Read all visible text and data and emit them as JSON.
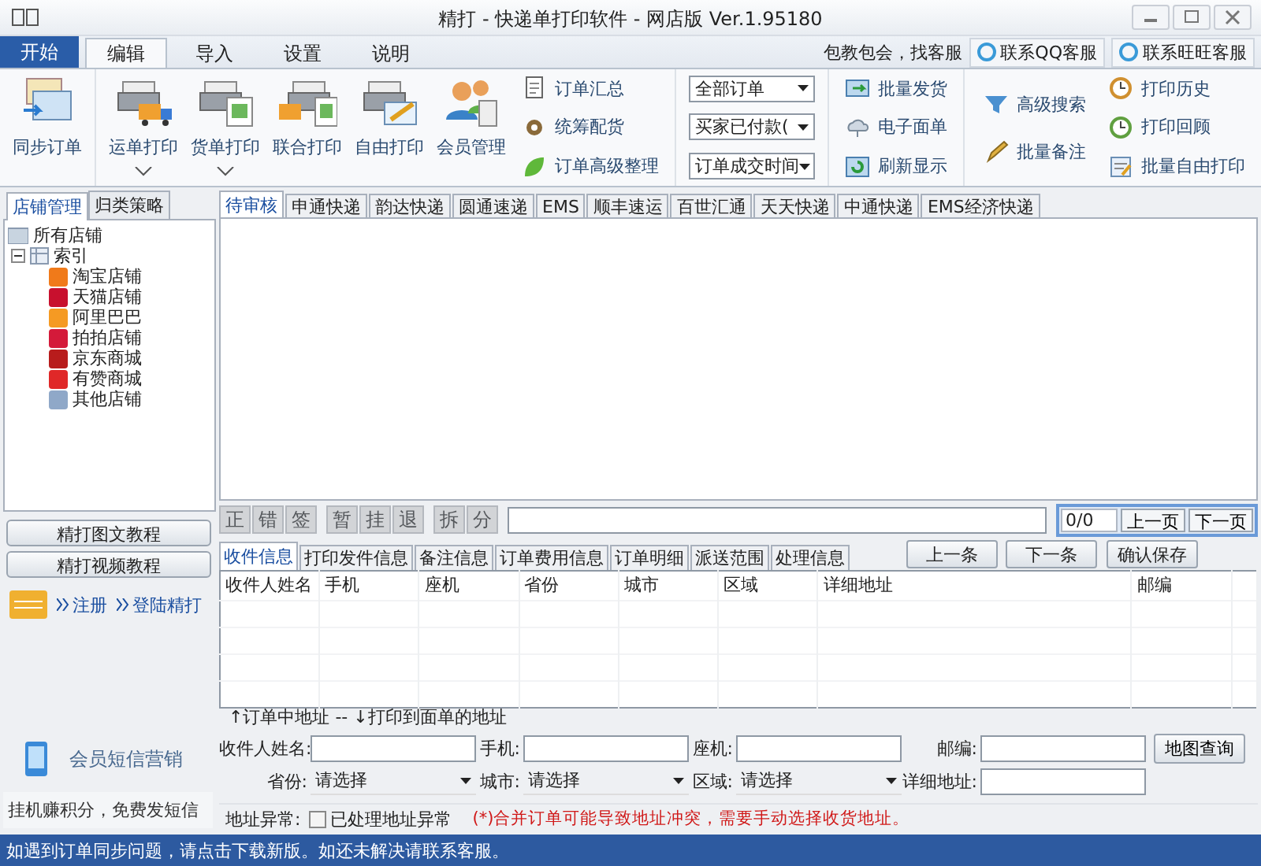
{
  "window": {
    "title": "精打 - 快递单打印软件 - 网店版 Ver.1.95180"
  },
  "ribbon_tabs": [
    {
      "label": "开始",
      "kind": "app",
      "selected": false
    },
    {
      "label": "编辑",
      "kind": "tab",
      "selected": true
    },
    {
      "label": "导入",
      "kind": "tab",
      "selected": false
    },
    {
      "label": "设置",
      "kind": "tab",
      "selected": false
    },
    {
      "label": "说明",
      "kind": "tab",
      "selected": false
    }
  ],
  "support": {
    "note": "包教包会，找客服",
    "buttons": [
      "联系QQ客服",
      "联系旺旺客服"
    ]
  },
  "ribbon": {
    "large_buttons": [
      {
        "label": "同步订单",
        "dropdown": false
      },
      {
        "label": "运单打印",
        "dropdown": true
      },
      {
        "label": "货单打印",
        "dropdown": true
      },
      {
        "label": "联合打印",
        "dropdown": false
      },
      {
        "label": "自由打印",
        "dropdown": false
      },
      {
        "label": "会员管理",
        "dropdown": false
      }
    ],
    "order_tools": [
      "订单汇总",
      "统筹配货",
      "订单高级整理"
    ],
    "dropdowns": [
      "全部订单",
      "买家已付款(",
      "订单成交时间"
    ],
    "ship_tools": [
      "批量发货",
      "电子面单",
      "刷新显示"
    ],
    "search_tools": [
      "高级搜索",
      "批量备注"
    ],
    "print_tools": [
      "打印历史",
      "打印回顾",
      "批量自由打印"
    ]
  },
  "sidebar": {
    "tabs": [
      {
        "label": "店铺管理",
        "selected": true
      },
      {
        "label": "归类策略",
        "selected": false
      }
    ],
    "shop_tree": {
      "label": "所有店铺",
      "children": [
        {
          "label": "索引",
          "expanded": true,
          "children": [
            {
              "label": "淘宝店铺",
              "color": "#f07a1a"
            },
            {
              "label": "天猫店铺",
              "color": "#c8102e"
            },
            {
              "label": "阿里巴巴",
              "color": "#f59a23"
            },
            {
              "label": "拍拍店铺",
              "color": "#d41a3a"
            },
            {
              "label": "京东商城",
              "color": "#b81c1c"
            },
            {
              "label": "有赞商城",
              "color": "#e02828"
            },
            {
              "label": "其他店铺",
              "color": "#8fa8c8"
            }
          ]
        }
      ]
    },
    "tutorials": [
      "精打图文教程",
      "精打视频教程"
    ],
    "account_links": [
      "注册",
      "登陆精打"
    ],
    "sms": "会员短信营销",
    "tip": "挂机赚积分，免费发短信"
  },
  "courier_tabs": [
    {
      "label": "待审核",
      "selected": true
    },
    {
      "label": "申通快递",
      "selected": false
    },
    {
      "label": "韵达快递",
      "selected": false
    },
    {
      "label": "圆通速递",
      "selected": false
    },
    {
      "label": "EMS",
      "selected": false
    },
    {
      "label": "顺丰速运",
      "selected": false
    },
    {
      "label": "百世汇通",
      "selected": false
    },
    {
      "label": "天天快递",
      "selected": false
    },
    {
      "label": "中通快递",
      "selected": false
    },
    {
      "label": "EMS经济快递",
      "selected": false
    }
  ],
  "action_groups": [
    [
      {
        "label": "正",
        "disabled": true
      },
      {
        "label": "错",
        "disabled": true
      },
      {
        "label": "签",
        "disabled": true
      }
    ],
    [
      {
        "label": "暂",
        "disabled": true
      },
      {
        "label": "挂",
        "disabled": true
      },
      {
        "label": "退",
        "disabled": true
      }
    ],
    [
      {
        "label": "拆",
        "disabled": true
      },
      {
        "label": "分",
        "disabled": true
      }
    ]
  ],
  "pager": {
    "count": "0/0",
    "buttons": [
      "上一页",
      "下一页"
    ]
  },
  "info_tabs": [
    {
      "label": "收件信息",
      "selected": true
    },
    {
      "label": "打印发件信息",
      "selected": false
    },
    {
      "label": "备注信息",
      "selected": false
    },
    {
      "label": "订单费用信息",
      "selected": false
    },
    {
      "label": "订单明细",
      "selected": false
    },
    {
      "label": "派送范围",
      "selected": false
    },
    {
      "label": "处理信息",
      "selected": false
    }
  ],
  "record_buttons": [
    "上一条",
    "下一条"
  ],
  "save_button": "确认保存",
  "table": {
    "columns": [
      "收件人姓名",
      "手机",
      "座机",
      "省份",
      "城市",
      "区域",
      "详细地址",
      "邮编"
    ]
  },
  "address_note": "↑订单中地址 -- ↓打印到面单的地址",
  "form": {
    "fields": [
      {
        "label": "收件人姓名:",
        "kind": "input"
      },
      {
        "label": "手机:",
        "kind": "input"
      },
      {
        "label": "座机:",
        "kind": "input"
      },
      {
        "label": "邮编:",
        "kind": "input"
      },
      {
        "label": "省份:",
        "kind": "select",
        "value": "请选择"
      },
      {
        "label": "城市:",
        "kind": "select",
        "value": "请选择"
      },
      {
        "label": "区域:",
        "kind": "select",
        "value": "请选择"
      },
      {
        "label": "详细地址:",
        "kind": "input"
      }
    ],
    "map_button": "地图查询"
  },
  "anomaly": {
    "label": "地址异常:",
    "checkbox": {
      "label": "已处理地址异常",
      "checked": false
    },
    "warning": "(*)合并订单可能导致地址冲突，需要手动选择收货地址。"
  },
  "status_bar": "如遇到订单同步问题，请点击下载新版。如还未解决请联系客服。"
}
